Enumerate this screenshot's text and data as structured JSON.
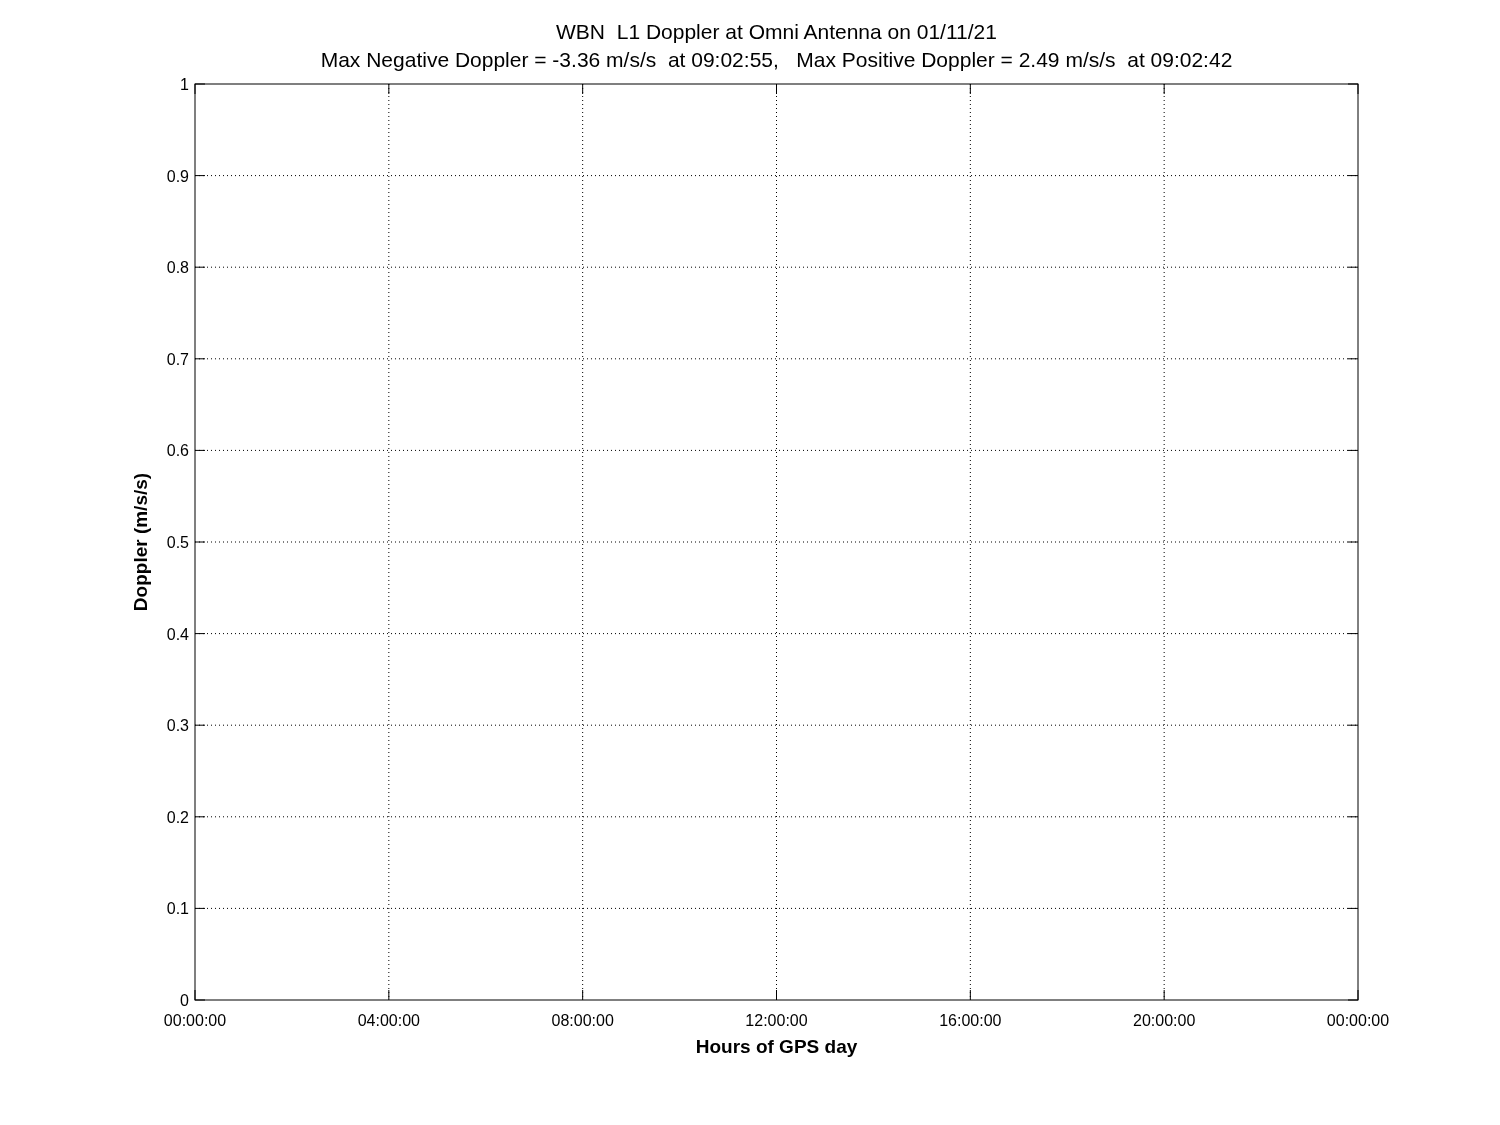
{
  "figure": {
    "chart_data": {
      "type": "line",
      "grid": true,
      "title": "WBN  L1 Doppler at Omni Antenna on 01/11/21",
      "subtitle": "Max Negative Doppler = -3.36 m/s/s  at 09:02:55,   Max Positive Doppler = 2.49 m/s/s  at 09:02:42",
      "xlabel": "Hours of GPS day",
      "ylabel": "Doppler (m/s/s)",
      "ylim": [
        0,
        1
      ],
      "categories": [
        "00:00:00",
        "04:00:00",
        "08:00:00",
        "12:00:00",
        "16:00:00",
        "20:00:00",
        "00:00:00"
      ],
      "yticks": [
        0,
        0.1,
        0.2,
        0.3,
        0.4,
        0.5,
        0.6,
        0.7,
        0.8,
        0.9,
        1
      ]
    }
  }
}
